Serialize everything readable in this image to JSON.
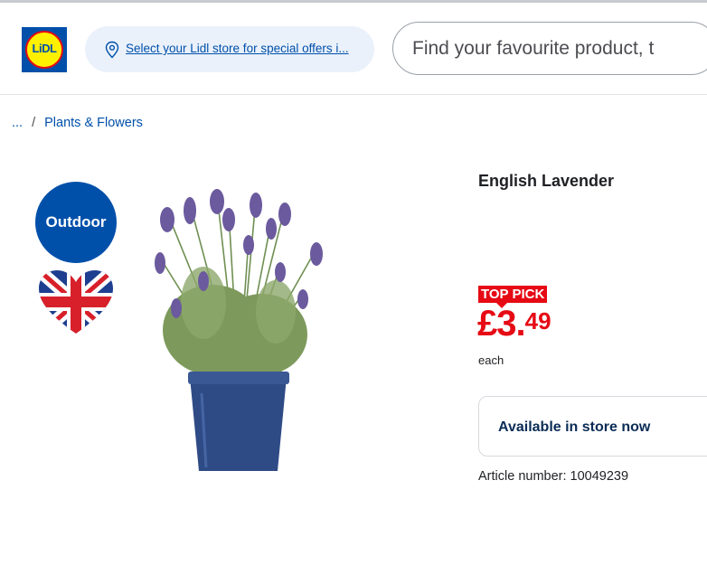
{
  "header": {
    "logo_text": "LiDL",
    "store_link": "Select your Lidl store for special offers i...",
    "search_placeholder": "Find your favourite product, t"
  },
  "breadcrumb": {
    "ellipsis": "...",
    "separator": "/",
    "current": "Plants & Flowers"
  },
  "badges": {
    "outdoor": "Outdoor",
    "flag_icon": "union-jack-heart-icon"
  },
  "product": {
    "title": "English Lavender",
    "promo_label": "TOP PICK",
    "price_main": "£3.",
    "price_pence": "49",
    "unit": "each",
    "availability": "Available in store now",
    "article_number": "Article number: 10049239"
  },
  "colors": {
    "brand_blue": "#0050aa",
    "brand_red": "#e60a14",
    "brand_yellow": "#fff000"
  }
}
